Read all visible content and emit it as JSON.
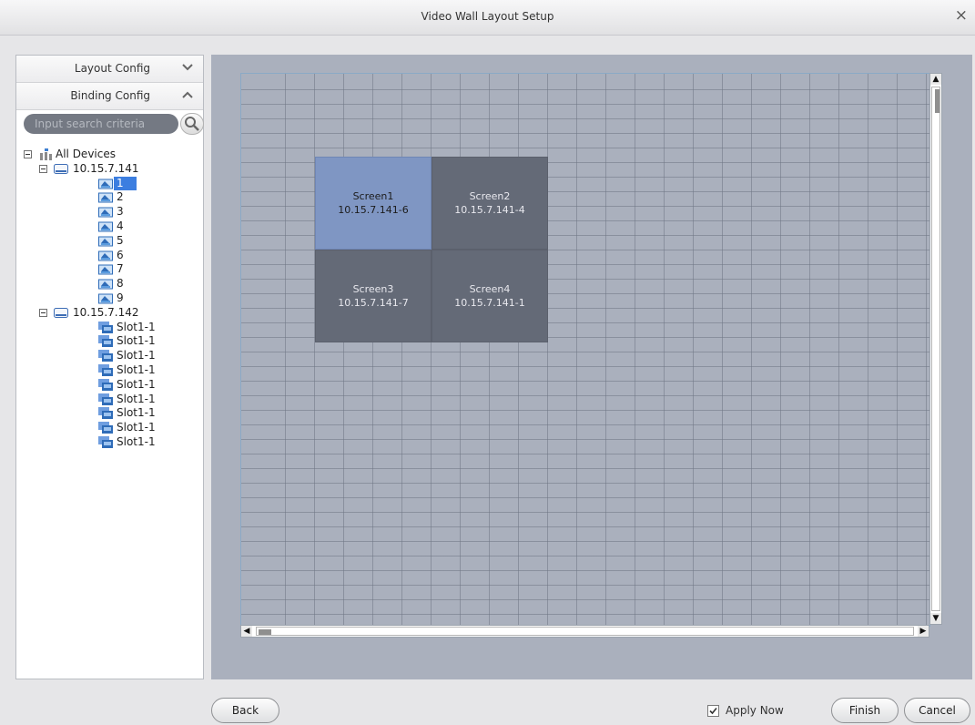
{
  "window": {
    "title": "Video Wall Layout Setup",
    "close_glyph": "×"
  },
  "left_panel": {
    "sections": [
      {
        "label": "Layout Config",
        "state": "collapsed"
      },
      {
        "label": "Binding Config",
        "state": "expanded"
      }
    ],
    "search_placeholder": "Input search criteria",
    "tree": {
      "root_label": "All Devices",
      "devices": [
        {
          "label": "10.15.7.141",
          "channels": [
            "1",
            "2",
            "3",
            "4",
            "5",
            "6",
            "7",
            "8",
            "9"
          ],
          "selected": "1"
        },
        {
          "label": "10.15.7.142",
          "channels": [
            "Slot1-1",
            "Slot1-1",
            "Slot1-1",
            "Slot1-1",
            "Slot1-1",
            "Slot1-1",
            "Slot1-1",
            "Slot1-1",
            "Slot1-1"
          ]
        }
      ]
    }
  },
  "screens": [
    {
      "name": "Screen1",
      "binding": "10.15.7.141-6",
      "active": true
    },
    {
      "name": "Screen2",
      "binding": "10.15.7.141-4",
      "active": false
    },
    {
      "name": "Screen3",
      "binding": "10.15.7.141-7",
      "active": false
    },
    {
      "name": "Screen4",
      "binding": "10.15.7.141-1",
      "active": false
    }
  ],
  "footer": {
    "back_label": "Back",
    "apply_now_label": "Apply Now",
    "apply_now_checked": true,
    "finish_label": "Finish",
    "cancel_label": "Cancel"
  },
  "colors": {
    "accent": "#3c7ee0",
    "canvas": "#aab0bd",
    "screen_active": "#7f96c3",
    "screen": "#646a77"
  }
}
